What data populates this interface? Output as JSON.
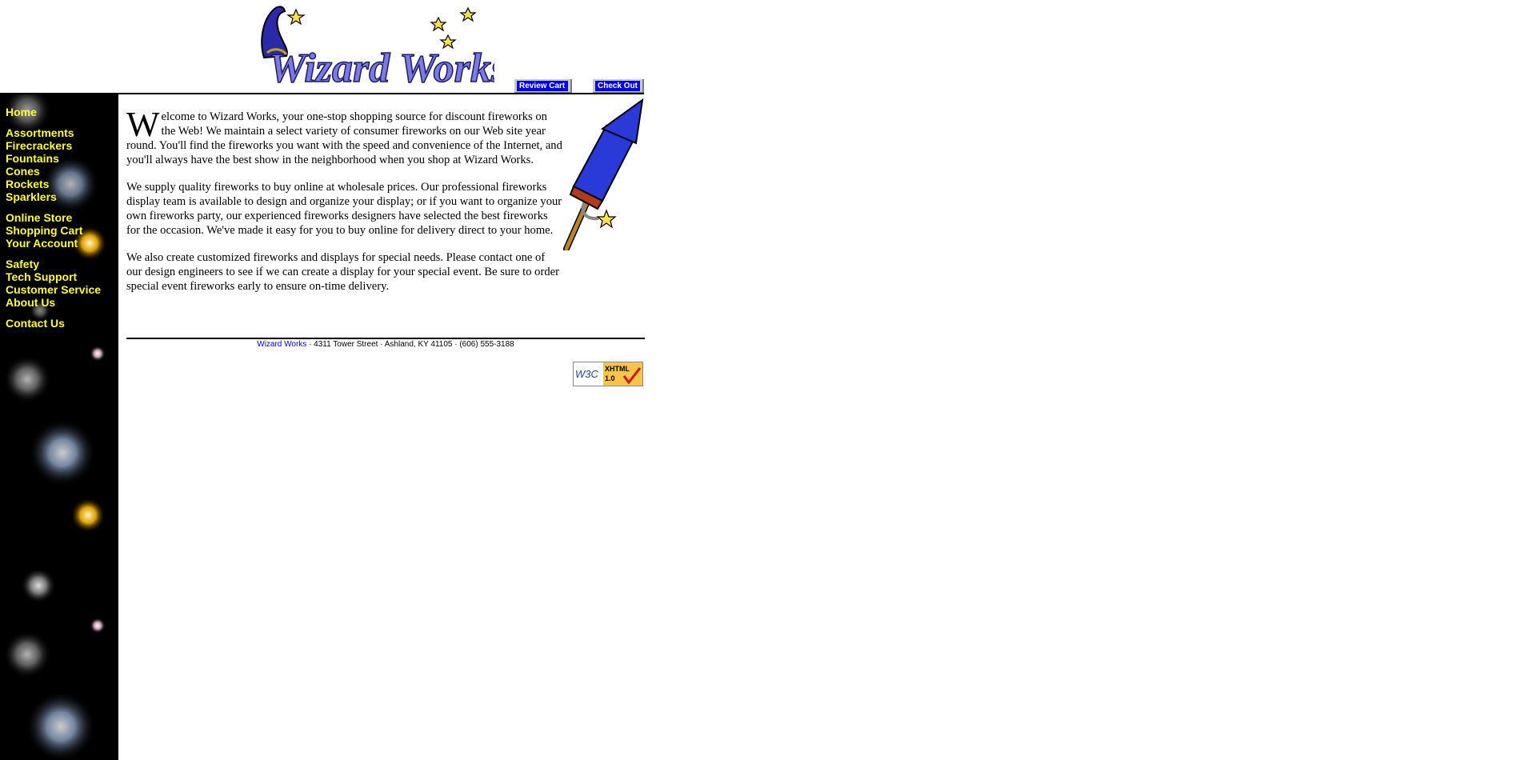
{
  "header": {
    "logo_text": "Wizard Works",
    "review_cart": "Review Cart",
    "check_out": "Check Out"
  },
  "nav": {
    "group1": [
      "Home"
    ],
    "group2": [
      "Assortments",
      "Firecrackers",
      "Fountains",
      "Cones",
      "Rockets",
      "Sparklers"
    ],
    "group3": [
      "Online Store",
      "Shopping Cart",
      "Your Account"
    ],
    "group4": [
      "Safety",
      "Tech Support",
      "Customer Service",
      "About Us"
    ],
    "group5": [
      "Contact Us"
    ]
  },
  "content": {
    "dropcap": "W",
    "p1_rest": "elcome to Wizard Works, your one-stop shopping source for discount fireworks on the Web! We maintain a select variety of consumer fireworks on our Web site year round. You'll find the fireworks you want with the speed and convenience of the Internet, and you'll always have the best show in the neighborhood when you shop at Wizard Works.",
    "p2": "We supply quality fireworks to buy online at wholesale prices. Our professional fireworks display team is available to design and organize your display; or if you want to organize your own fireworks party, our experienced fireworks designers have selected the best fireworks for the occasion. We've made it easy for you to buy online for delivery direct to your home.",
    "p3": "We also create customized fireworks and displays for special needs. Please contact one of our design engineers to see if we can create a display for your special event. Be sure to order special event fireworks early to ensure on-time delivery."
  },
  "footer": {
    "company_link": "Wizard Works",
    "address": " · 4311 Tower Street · Ashland, KY 41105 · (606) 555-3188"
  },
  "badge": {
    "w3c": "W3C",
    "xhtml": "XHTML",
    "version": "1.0"
  },
  "colors": {
    "nav_text": "#ffff33",
    "link": "#0000ee",
    "sidebar_bg": "#000000",
    "logo_fill": "#7b7be0"
  }
}
